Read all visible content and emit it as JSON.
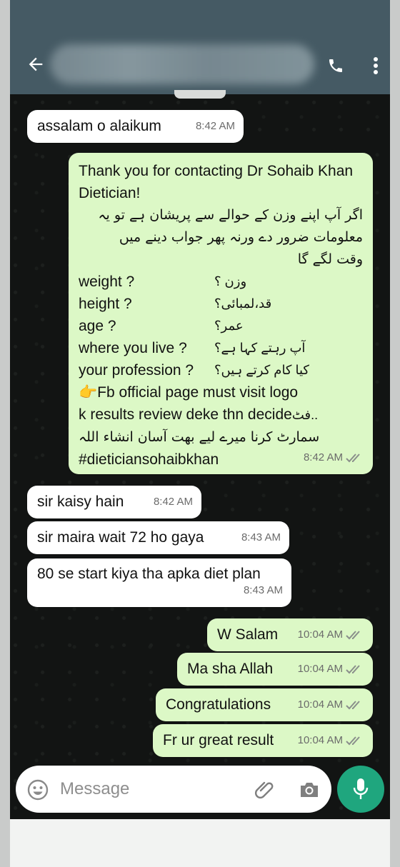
{
  "composer": {
    "placeholder": "Message"
  },
  "messages": [
    {
      "direction": "in",
      "text": "assalam o alaikum",
      "time": "8:42 AM"
    },
    {
      "direction": "out",
      "intro": "Thank you for contacting Dr Sohaib Khan Dietician!",
      "urdu_lines": [
        "اگر آپ اپنے وزن کے حوالے سے پریشان ہے تو یہ",
        "معلومات ضرور دے ورنہ پھر جواب دینے میں",
        "وقت لگے گا"
      ],
      "fields": [
        {
          "en": "weight ?",
          "ur": "وزن ؟"
        },
        {
          "en": "height ?",
          "ur": "قد،لمبائی؟"
        },
        {
          "en": "age  ?",
          "ur": "عمر؟"
        },
        {
          "en": "where you live ?",
          "ur": "آپ رہتے کہا ہے؟"
        },
        {
          "en": "your profession ?",
          "ur": "کیا کام کرتے ہیں؟"
        }
      ],
      "fb_line": "Fb official page must visit logo",
      "review_line": "k results review deke thn decide",
      "review_suffix": "فٹ..",
      "closing_urdu": "سمارٹ کرنا میرے لیے بھت آسان انشاء اللہ",
      "hashtag": "#dieticiansohaibkhan",
      "time": "8:42 AM",
      "pointing_emoji": "👉"
    },
    {
      "direction": "in",
      "text": "sir kaisy hain",
      "time": "8:42 AM"
    },
    {
      "direction": "in",
      "text": "sir maira wait 72 ho gaya",
      "time": "8:43 AM"
    },
    {
      "direction": "in",
      "text": "80 se start kiya tha apka diet plan",
      "time": "8:43 AM"
    },
    {
      "direction": "out",
      "text": "W Salam",
      "time": "10:04 AM"
    },
    {
      "direction": "out",
      "text": "Ma sha Allah",
      "time": "10:04 AM"
    },
    {
      "direction": "out",
      "text": "Congratulations",
      "time": "10:04 AM"
    },
    {
      "direction": "out",
      "text": "Fr ur great result",
      "time": "10:04 AM"
    }
  ],
  "colors": {
    "header": "#455a64",
    "incoming_bubble": "#ffffff",
    "outgoing_bubble": "#dcf8c6",
    "mic_button": "#1fa67e",
    "tick": "#8a8f8b"
  },
  "icons": [
    "back-arrow-icon",
    "call-icon",
    "overflow-menu-icon",
    "emoji-icon",
    "attach-icon",
    "camera-icon",
    "mic-icon",
    "double-tick-icon"
  ]
}
